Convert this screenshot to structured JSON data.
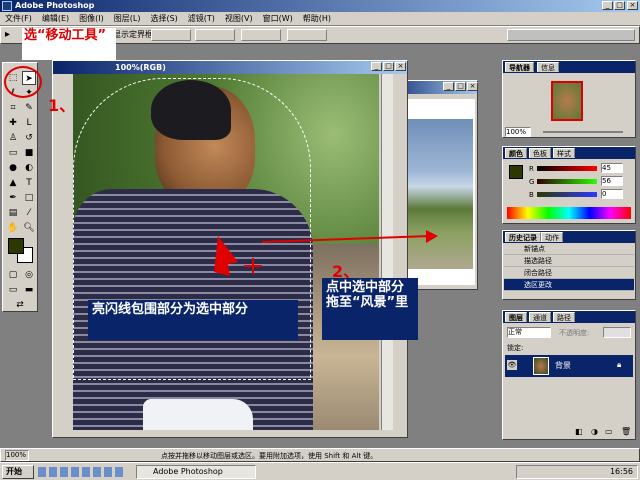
{
  "window": {
    "title": "Adobe Photoshop"
  },
  "menu": [
    "文件(F)",
    "编辑(E)",
    "图像(I)",
    "图层(L)",
    "选择(S)",
    "滤镜(T)",
    "视图(V)",
    "窗口(W)",
    "帮助(H)"
  ],
  "options_bar": {
    "bounding_label": "显示定界框"
  },
  "document": {
    "title": "100%(RGB)"
  },
  "navigator": {
    "tabs": [
      "导航器",
      "信息"
    ],
    "zoom": "100%"
  },
  "color": {
    "tabs": [
      "颜色",
      "色板",
      "样式"
    ],
    "r": "45",
    "g": "56",
    "b": "0",
    "r_label": "R",
    "g_label": "G",
    "b_label": "B"
  },
  "history": {
    "tabs": [
      "历史记录",
      "动作"
    ],
    "items": [
      "新锚点",
      "描选路径",
      "闭合路径",
      "选区更改"
    ]
  },
  "layers": {
    "tabs": [
      "图层",
      "通道",
      "路径"
    ],
    "blend_mode": "正常",
    "opacity_label": "不透明度:",
    "lock_label": "锁定:",
    "layer_name": "背景"
  },
  "status": {
    "zoom": "100%",
    "hint": "点按并拖移以移动图层或选区。要用附加选项，使用 Shift 和 Alt 键。"
  },
  "taskbar": {
    "start": "开始",
    "app": "Adobe Photoshop",
    "time": "16:56"
  },
  "annotations": {
    "step1_text": "选“移动工具”",
    "step1_num": "1、",
    "step2_num": "2、",
    "step2_text": "点中选中部分拖至“风景”里",
    "selection_text": "亮闪线包围部分为选中部分"
  },
  "colors": {
    "title_bar": "#0a246a",
    "highlight": "#0a246a",
    "foreground_swatch": "#2d3800",
    "annotation_red": "#e00000"
  }
}
